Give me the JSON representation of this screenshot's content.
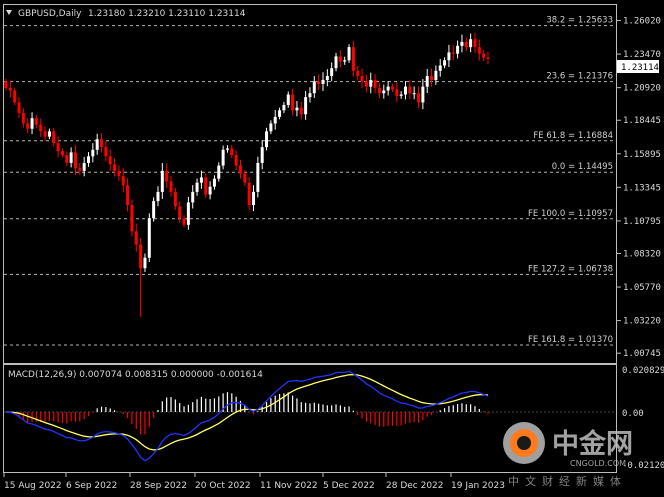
{
  "header": {
    "symbol": "GBPUSD,Daily",
    "ohlc": "1.23180 1.23210 1.23110 1.23114",
    "menu_icon": "triangle-down-icon"
  },
  "price_axis": {
    "ticks": [
      "1.26020",
      "1.23470",
      "1.20920",
      "1.18445",
      "1.15895",
      "1.13345",
      "1.10795",
      "1.08320",
      "1.05770",
      "1.03220",
      "1.00745"
    ],
    "current_price": "1.23114"
  },
  "fib_levels": [
    {
      "label": "38.2 = 1.25633",
      "price": 1.25633
    },
    {
      "label": "23.6 = 1.21376",
      "price": 1.21376
    },
    {
      "label": "FE 61.8 = 1.16884",
      "price": 1.16884
    },
    {
      "label": "0.0 = 1.14495",
      "price": 1.14495
    },
    {
      "label": "FE 100.0 = 1.10957",
      "price": 1.10957
    },
    {
      "label": "FE 127.2 = 1.06738",
      "price": 1.06738
    },
    {
      "label": "FE 161.8 = 1.01370",
      "price": 1.0137
    }
  ],
  "macd": {
    "title": "MACD(12,26,9) 0.007074 0.008315 0.000000 -0.001614",
    "ticks": [
      "0.020829",
      "0.00",
      "-0.021204"
    ]
  },
  "time_axis": [
    "15 Aug 2022",
    "6 Sep 2022",
    "28 Sep 2022",
    "20 Oct 2022",
    "11 Nov 2022",
    "5 Dec 2022",
    "28 Dec 2022",
    "19 Jan 2023"
  ],
  "watermark": {
    "cn": "中金网",
    "en": "CNGOLD.COM",
    "sub": "中文财经新媒体",
    "logo_icon": "cngold-logo-icon"
  },
  "colors": {
    "background": "#000000",
    "bull": "#ffffff",
    "bear": "#ff0000",
    "grid": "#b4b4b4",
    "macd_signal": "#ffff66",
    "macd_line": "#2233ff"
  },
  "chart_data": {
    "type": "candlestick",
    "interval": "Daily",
    "ylim": [
      1.0,
      1.272
    ],
    "closes": [
      1.209,
      1.207,
      1.198,
      1.19,
      1.182,
      1.178,
      1.186,
      1.181,
      1.176,
      1.172,
      1.176,
      1.167,
      1.161,
      1.158,
      1.152,
      1.16,
      1.148,
      1.146,
      1.152,
      1.157,
      1.162,
      1.17,
      1.164,
      1.157,
      1.151,
      1.146,
      1.142,
      1.135,
      1.12,
      1.1,
      1.09,
      1.072,
      1.08,
      1.11,
      1.123,
      1.13,
      1.146,
      1.138,
      1.13,
      1.119,
      1.11,
      1.105,
      1.122,
      1.13,
      1.137,
      1.141,
      1.128,
      1.134,
      1.14,
      1.15,
      1.162,
      1.163,
      1.158,
      1.15,
      1.144,
      1.137,
      1.12,
      1.13,
      1.152,
      1.164,
      1.176,
      1.182,
      1.187,
      1.192,
      1.196,
      1.204,
      1.192,
      1.194,
      1.189,
      1.202,
      1.205,
      1.214,
      1.212,
      1.215,
      1.218,
      1.224,
      1.233,
      1.229,
      1.23,
      1.24,
      1.222,
      1.218,
      1.214,
      1.21,
      1.215,
      1.209,
      1.205,
      1.207,
      1.21,
      1.208,
      1.203,
      1.204,
      1.21,
      1.205,
      1.205,
      1.198,
      1.21,
      1.218,
      1.215,
      1.222,
      1.226,
      1.23,
      1.236,
      1.235,
      1.241,
      1.244,
      1.24,
      1.246,
      1.24,
      1.235,
      1.232,
      1.231
    ]
  }
}
